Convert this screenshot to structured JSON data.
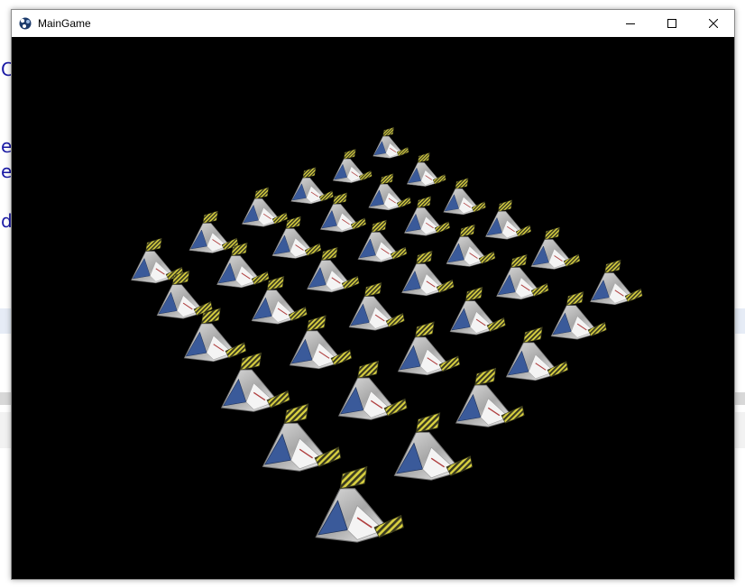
{
  "window": {
    "title": "MainGame",
    "icon": "app-gear-icon",
    "controls": {
      "minimize_icon": "minimize-icon",
      "maximize_icon": "maximize-icon",
      "close_icon": "close-icon"
    }
  },
  "colors": {
    "titlebar": "#ffffff",
    "viewport": "#000000",
    "ship_hull": "#c8c8c8",
    "ship_window": "#3a5a9a",
    "ship_stripe_yellow": "#d8d040",
    "ship_stripe_dark": "#3a3a20"
  }
}
